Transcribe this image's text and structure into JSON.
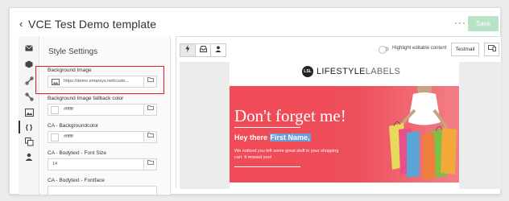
{
  "header": {
    "back_glyph": "‹",
    "title": "VCE Test Demo template",
    "more_glyph": "···",
    "save_label": "Save"
  },
  "sidebar_icons": [
    "mail-icon",
    "box-icon",
    "link-icon",
    "link-alt-icon",
    "image-icon",
    "code-icon",
    "copy-icon",
    "user-icon"
  ],
  "panel": {
    "title": "Style Settings",
    "fields": [
      {
        "label": "Background Image",
        "value": "https://demo.emarsys.net/custo..."
      },
      {
        "label": "Background Image fallback color",
        "value": "#ffffff"
      },
      {
        "label": "CA - Backgroundcolor",
        "value": "#ffffff"
      },
      {
        "label": "CA - Bodytext - Font Size",
        "value": "14"
      },
      {
        "label": "CA - Bodytext - Fontface",
        "value": ""
      }
    ]
  },
  "preview": {
    "highlight_label": "Highlight editable content",
    "testmail_label": "Testmail",
    "email": {
      "logo_bold": "LIFESTYLE",
      "logo_light": "LABELS",
      "headline": "Don't forget me!",
      "greeting": "Hey there ",
      "name": "First Name,",
      "body": "We noticed you left some great stuff in your shopping cart. It missed you!"
    }
  },
  "colors": {
    "hero_red": "#f04b57",
    "save_green": "#b7e3c7",
    "highlight_red": "#e02020",
    "name_highlight": "#6c9bd9"
  }
}
